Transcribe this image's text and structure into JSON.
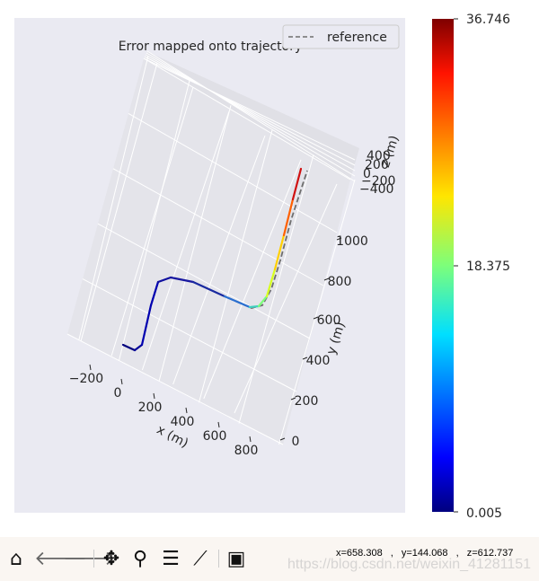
{
  "chart_data": {
    "type": "line",
    "projection": "3d",
    "title": "Error mapped onto trajectory",
    "xlabel": "x (m)",
    "ylabel": "y (m)",
    "zlabel": "z (m)",
    "x_ticks": [
      "−200",
      "0",
      "200",
      "400",
      "600",
      "800"
    ],
    "y_ticks": [
      "0",
      "200",
      "400",
      "600",
      "800",
      "1000"
    ],
    "z_ticks": [
      "400",
      "200",
      "0",
      "−200",
      "−400"
    ],
    "legend": {
      "entries": [
        "reference"
      ],
      "placement": "top-right"
    },
    "series": [
      {
        "name": "reference",
        "style": "dashed",
        "color": "#6e6e6e"
      }
    ],
    "colorbar": {
      "colormap": "jet",
      "min": 0.005,
      "max": 36.746,
      "ticks": [
        "36.746",
        "18.375",
        "0.005"
      ]
    },
    "grid": true,
    "background": "#eaeaf2"
  },
  "toolbar": {
    "buttons": [
      "home",
      "back",
      "forward",
      "pan",
      "zoom",
      "configure",
      "edit-axes",
      "save"
    ],
    "coords": "x=658.308 , y=144.068 , z=612.737"
  },
  "watermark": "https://blog.csdn.net/weixin_41281151"
}
